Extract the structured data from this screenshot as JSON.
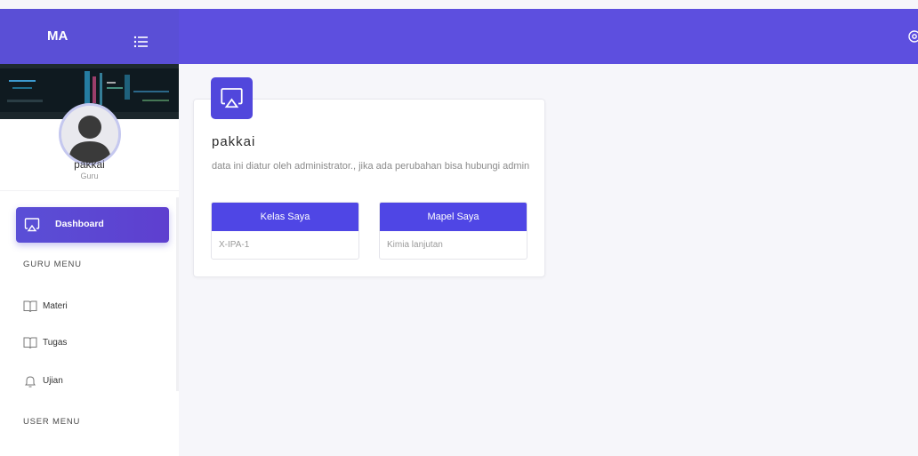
{
  "brand": {
    "text": "MA"
  },
  "user": {
    "name": "pakkai",
    "role": "Guru"
  },
  "sidebar": {
    "active_item": {
      "label": "Dashboard",
      "icon": "airplay-icon"
    },
    "sections": [
      {
        "title": "GURU MENU"
      },
      {
        "title": "USER MENU"
      }
    ],
    "items": [
      {
        "label": "Materi",
        "icon": "book-icon"
      },
      {
        "label": "Tugas",
        "icon": "book-icon"
      },
      {
        "label": "Ujian",
        "icon": "bell-icon"
      }
    ]
  },
  "card": {
    "icon": "airplay-icon",
    "title": "pakkai",
    "description": "data ini diatur oleh administrator., jika ada perubahan bisa hubungi admin",
    "tiles": [
      {
        "header": "Kelas Saya",
        "value": "X-IPA-1"
      },
      {
        "header": "Mapel Saya",
        "value": "Kimia lanjutan"
      }
    ]
  },
  "colors": {
    "primary": "#5a4fd6",
    "tile_header": "#4f46e5",
    "background": "#f6f6fa"
  }
}
